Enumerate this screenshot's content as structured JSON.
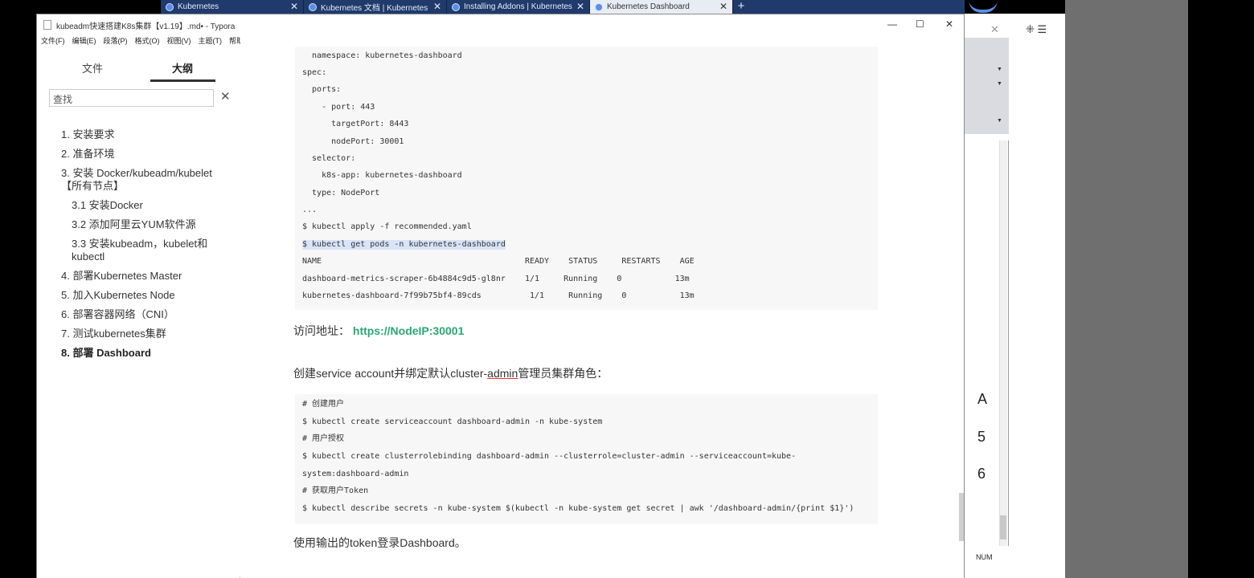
{
  "browser_tabs": [
    {
      "label": "Kubernetes"
    },
    {
      "label": "Kubernetes 文档 | Kubernetes"
    },
    {
      "label": "Installing Addons | Kubernetes"
    },
    {
      "label": "Kubernetes Dashboard"
    }
  ],
  "window": {
    "title": "kubeadm快速搭建K8s集群【v1.19】.md• - Typora",
    "minimize": "—",
    "maximize": "☐",
    "close": "✕"
  },
  "menu": [
    "文件(F)",
    "编辑(E)",
    "段落(P)",
    "格式(O)",
    "视图(V)",
    "主题(T)",
    "帮助(H)"
  ],
  "sidebar": {
    "tab_files": "文件",
    "tab_outline": "大纲",
    "search_placeholder": "查找",
    "outline": [
      {
        "label": "1. 安装要求",
        "level": 1
      },
      {
        "label": "2. 准备环境",
        "level": 1
      },
      {
        "label": "3. 安装 Docker/kubeadm/kubelet【所有节点】",
        "level": 1
      },
      {
        "label": "3.1 安装Docker",
        "level": 2
      },
      {
        "label": "3.2 添加阿里云YUM软件源",
        "level": 2
      },
      {
        "label": "3.3 安装kubeadm，kubelet和kubectl",
        "level": 2
      },
      {
        "label": "4. 部署Kubernetes Master",
        "level": 1
      },
      {
        "label": "5. 加入Kubernetes Node",
        "level": 1
      },
      {
        "label": "6. 部署容器网络（CNI）",
        "level": 1
      },
      {
        "label": "7. 测试kubernetes集群",
        "level": 1
      },
      {
        "label": "8. 部署 Dashboard",
        "level": 1,
        "active": true
      }
    ]
  },
  "code1": [
    "  namespace: kubernetes-dashboard",
    "spec:",
    "  ports:",
    "    - port: 443",
    "      targetPort: 8443",
    "      nodePort: 30001",
    "  selector:",
    "    k8s-app: kubernetes-dashboard",
    "  type: NodePort",
    "...",
    "$ kubectl apply -f recommended.yaml",
    "$ kubectl get pods -n kubernetes-dashboard",
    "NAME                                          READY    STATUS     RESTARTS    AGE",
    "dashboard-metrics-scraper-6b4884c9d5-gl8nr    1/1     Running    0           13m",
    "kubernetes-dashboard-7f99b75bf4-89cds          1/1     Running    0           13m"
  ],
  "access": {
    "label": "访问地址：",
    "url": "https://NodeIP:30001"
  },
  "para2": {
    "before": "创建service account并绑定默认cluster-",
    "underlined": "admin",
    "after": "管理员集群角色："
  },
  "code2": [
    "# 创建用户",
    "$ kubectl create serviceaccount dashboard-admin -n kube-system",
    "# 用户授权",
    "$ kubectl create clusterrolebinding dashboard-admin --clusterrole=cluster-admin --serviceaccount=kube-",
    "system:dashboard-admin",
    "# 获取用户Token",
    "$ kubectl describe secrets -n kube-system $(kubectl -n kube-system get secret | awk '/dashboard-admin/{print $1}')"
  ],
  "para3": "使用输出的token登录Dashboard。",
  "right_app": {
    "chars": [
      "A",
      "5",
      "6"
    ],
    "status": "NUM"
  },
  "colors": {
    "link": "#2aa872",
    "tabbar": "#1f3a6b",
    "code_bg": "#f7f7f7"
  }
}
